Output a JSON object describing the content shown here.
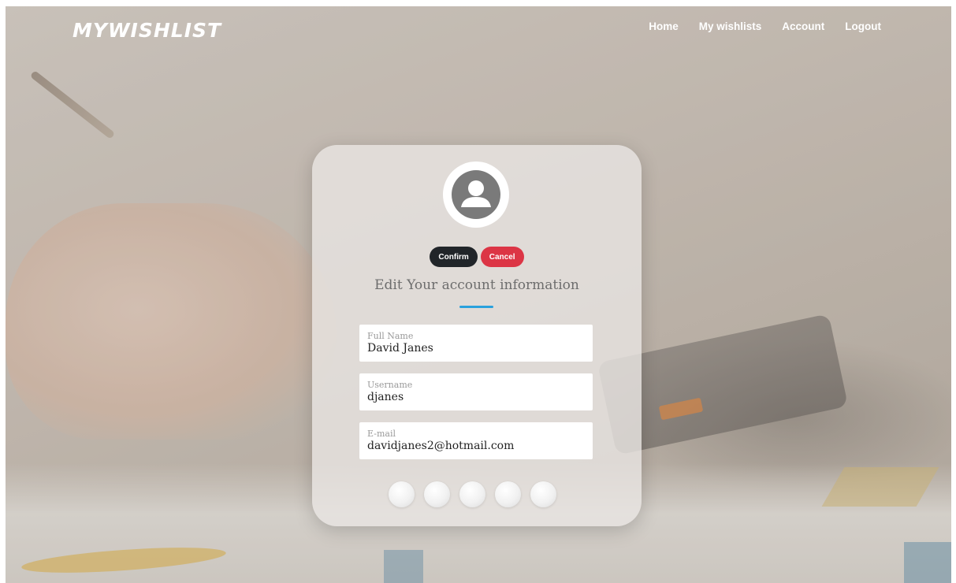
{
  "brand": {
    "logo_text": "MYWISHLIST"
  },
  "nav": {
    "items": [
      {
        "label": "Home"
      },
      {
        "label": "My wishlists"
      },
      {
        "label": "Account"
      },
      {
        "label": "Logout"
      }
    ]
  },
  "card": {
    "avatar_icon": "user-avatar-icon",
    "confirm_label": "Confirm",
    "cancel_label": "Cancel",
    "heading": "Edit Your account information",
    "accent_color": "#2aa1dd",
    "fields": [
      {
        "label": "Full Name",
        "value": "David Janes"
      },
      {
        "label": "Username",
        "value": "djanes"
      },
      {
        "label": "E-mail",
        "value": "davidjanes2@hotmail.com"
      }
    ],
    "options_count": 5
  },
  "colors": {
    "confirm": "#212529",
    "cancel": "#dc3545"
  }
}
